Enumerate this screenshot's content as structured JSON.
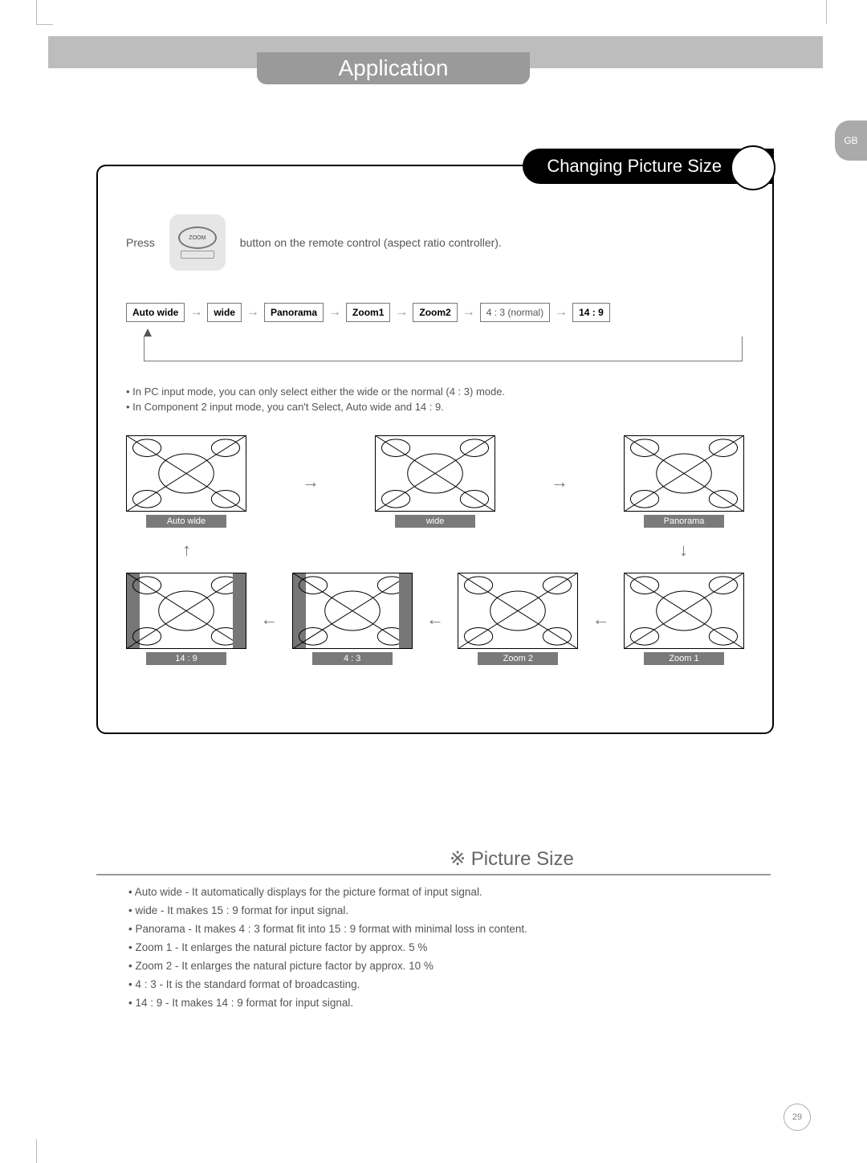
{
  "header": {
    "tab": "Application",
    "lang_badge": "GB"
  },
  "section1": {
    "title": "Changing Picture Size",
    "press_label": "Press",
    "zoom_button_text": "ZOOM",
    "press_after": "button on the remote control (aspect ratio controller).",
    "cycle": [
      "Auto wide",
      "wide",
      "Panorama",
      "Zoom1",
      "Zoom2",
      "4 : 3 (normal)",
      "14 : 9"
    ],
    "cycle_bold": [
      true,
      true,
      true,
      true,
      true,
      false,
      true
    ],
    "notes": [
      "• In PC input mode, you can only select either the wide or the normal (4 : 3) mode.",
      "• In Component 2 input mode, you can't Select,  Auto wide and 14 : 9."
    ],
    "diagram_top": [
      "Auto wide",
      "wide",
      "Panorama"
    ],
    "diagram_bottom": [
      "14 : 9",
      "4 : 3",
      "Zoom 2",
      "Zoom 1"
    ]
  },
  "section2": {
    "title": "※ Picture Size",
    "items": [
      "• Auto wide - It automatically displays for the picture format of input signal.",
      "• wide - It makes 15 : 9 format for input signal.",
      "• Panorama - It makes 4 : 3 format fit into 15 : 9 format with minimal loss in content.",
      "• Zoom 1 - It enlarges the natural picture factor by approx. 5 %",
      "• Zoom 2 - It enlarges the natural picture factor by approx. 10 %",
      "• 4 : 3 - It is the standard format of broadcasting.",
      "• 14 : 9 - It makes 14 : 9 format for input signal."
    ]
  },
  "page_number": "29"
}
